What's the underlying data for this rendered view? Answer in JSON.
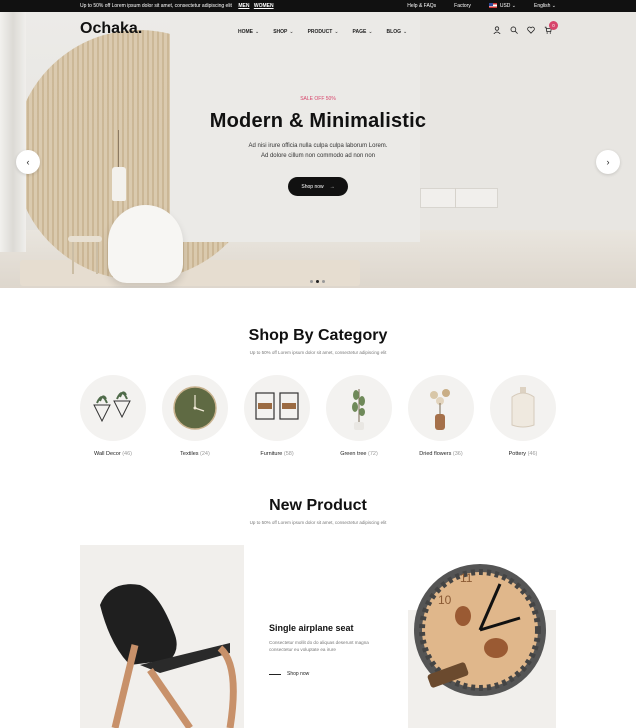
{
  "topbar": {
    "promo": "Up to 50% off Lorem ipsum dolor sit amet, consectetur adipiscing elit",
    "links": [
      "MEN",
      "WOMEN"
    ],
    "help": "Help & FAQs",
    "factory": "Factory",
    "currency": "USD",
    "language": "English"
  },
  "header": {
    "logo": "Ochaka.",
    "nav": [
      "HOME",
      "SHOP",
      "PRODUCT",
      "PAGE",
      "BLOG"
    ],
    "cart_count": "0"
  },
  "hero": {
    "sale_tag": "SALE OFF 50%",
    "title": "Modern & Minimalistic",
    "desc_line1": "Ad nisi irure officia nulla culpa culpa laborum Lorem.",
    "desc_line2": "Ad dolore cillum non commodo ad non non",
    "button": "Shop now",
    "slide_count": 3,
    "active_slide": 2
  },
  "categories": {
    "title": "Shop By Category",
    "subtitle": "Up to 50% off Lorem ipsum dolor sit amet, consectetur adipiscing elit",
    "items": [
      {
        "name": "Wall Decor",
        "count": "(46)"
      },
      {
        "name": "Textiles",
        "count": "(24)"
      },
      {
        "name": "Furniture",
        "count": "(58)"
      },
      {
        "name": "Green tree",
        "count": "(72)"
      },
      {
        "name": "Dried flowers",
        "count": "(36)"
      },
      {
        "name": "Pottery",
        "count": "(46)"
      }
    ]
  },
  "new_product": {
    "title": "New Product",
    "subtitle": "Up to 50% off Lorem ipsum dolor sit amet, consectetur adipiscing elit",
    "product": {
      "name": "Single airplane seat",
      "desc": "Consectetur mollit do do aliquas deserunt magna consectetur eu voluptate ea irure",
      "link": "Shop now"
    }
  },
  "colors": {
    "accent": "#d7456b",
    "dark": "#111111"
  }
}
